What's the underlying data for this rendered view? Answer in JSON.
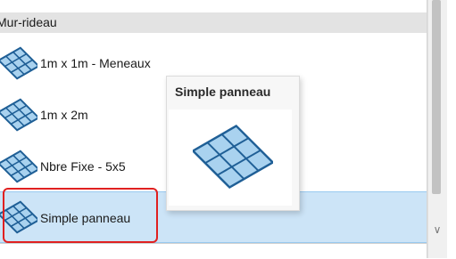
{
  "group": {
    "title": "Mur-rideau"
  },
  "items": [
    {
      "label": "1m x 1m - Meneaux",
      "icon": "curtain-wall-grid-icon"
    },
    {
      "label": "1m x 2m",
      "icon": "curtain-wall-grid-icon"
    },
    {
      "label": "Nbre Fixe - 5x5",
      "icon": "curtain-wall-grid-icon"
    },
    {
      "label": "Simple panneau",
      "icon": "curtain-wall-grid-icon",
      "selected": true
    }
  ],
  "tooltip": {
    "title": "Simple panneau",
    "preview_icon": "curtain-wall-grid-icon"
  },
  "colors": {
    "selection_bg": "#cce4f7",
    "highlight": "#e02020",
    "grid_fill": "#a9d2ef",
    "grid_stroke": "#1f5f96",
    "header_bg": "#e3e3e3"
  }
}
